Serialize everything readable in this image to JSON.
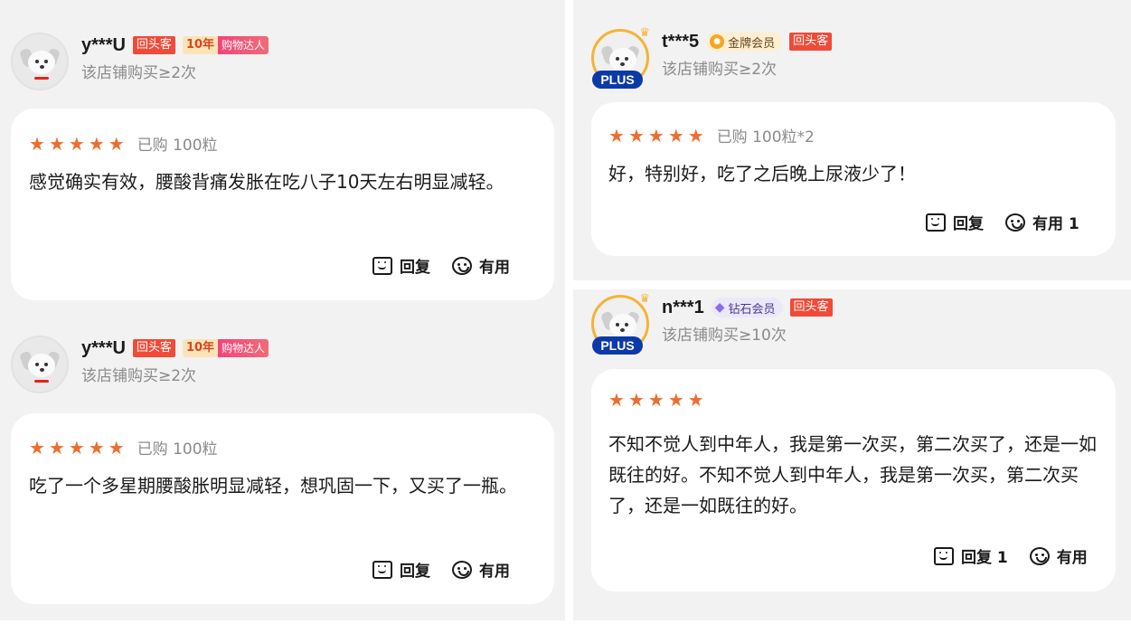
{
  "reviews": [
    {
      "username": "y***U",
      "tags": {
        "returning": "回头客",
        "years": "10年",
        "badge": "购物达人"
      },
      "purchase_count": "该店铺购买≥2次",
      "rating": 5,
      "bought": "已购 100粒",
      "content": "感觉确实有效，腰酸背痛发胀在吃八子10天左右明显减轻。",
      "reply_label": "回复",
      "useful_label": "有用"
    },
    {
      "username": "y***U",
      "tags": {
        "returning": "回头客",
        "years": "10年",
        "badge": "购物达人"
      },
      "purchase_count": "该店铺购买≥2次",
      "rating": 5,
      "bought": "已购 100粒",
      "content": "吃了一个多星期腰酸胀明显减轻，想巩固一下，又买了一瓶。",
      "reply_label": "回复",
      "useful_label": "有用"
    },
    {
      "username": "t***5",
      "plus": "PLUS",
      "tags": {
        "member": "金牌会员",
        "returning": "回头客"
      },
      "purchase_count": "该店铺购买≥2次",
      "rating": 5,
      "bought": "已购 100粒*2",
      "content": "好，特别好，吃了之后晚上尿液少了！",
      "reply_label": "回复",
      "useful_label": "有用 1"
    },
    {
      "username": "n***1",
      "plus": "PLUS",
      "tags": {
        "member": "钻石会员",
        "returning": "回头客"
      },
      "purchase_count": "该店铺购买≥10次",
      "rating": 5,
      "content": "不知不觉人到中年人，我是第一次买，第二次买了，还是一如既往的好。不知不觉人到中年人，我是第一次买，第二次买了，还是一如既往的好。",
      "reply_label": "回复 1",
      "useful_label": "有用"
    }
  ],
  "colors": {
    "star": "#ee6d2d",
    "tag_red": "#f04a38",
    "plus_blue": "#0b3aa8",
    "gold_ring": "#f5b335"
  },
  "icons": [
    "dog-avatar-icon",
    "star-icon",
    "reply-icon",
    "useful-icon",
    "gold-medal-icon",
    "diamond-icon",
    "crown-icon"
  ]
}
